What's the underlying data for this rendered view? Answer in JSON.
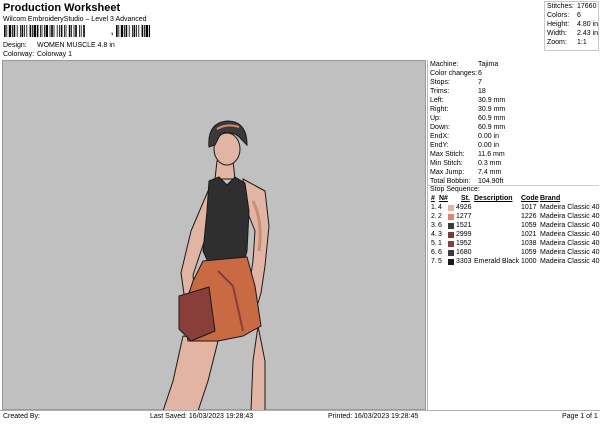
{
  "header": {
    "title": "Production Worksheet",
    "subtitle": "Wilcom EmbroideryStudio – Level 3 Advanced",
    "barcode_suffix": ",",
    "design_label": "Design:",
    "design_value": "WOMEN MUSCLE 4.8 in",
    "colorway_label": "Colorway:",
    "colorway_value": "Colorway 1"
  },
  "stats": [
    {
      "label": "Stitches:",
      "value": "17660"
    },
    {
      "label": "Colors:",
      "value": "6"
    },
    {
      "label": "Height:",
      "value": "4.80 in"
    },
    {
      "label": "Width:",
      "value": "2.43 in"
    },
    {
      "label": "Zoom:",
      "value": "1:1"
    }
  ],
  "machine_info": [
    {
      "label": "Machine:",
      "value": "Tajima"
    },
    {
      "label": "Color changes:",
      "value": "6"
    },
    {
      "label": "Stops:",
      "value": "7"
    },
    {
      "label": "Trims:",
      "value": "18"
    },
    {
      "label": "Left:",
      "value": "30.9 mm"
    },
    {
      "label": "Right:",
      "value": "30.9 mm"
    },
    {
      "label": "Up:",
      "value": "60.9 mm"
    },
    {
      "label": "Down:",
      "value": "60.9 mm"
    },
    {
      "label": "EndX:",
      "value": "0.00 in"
    },
    {
      "label": "EndY:",
      "value": "0.00 in"
    },
    {
      "label": "Max Stitch:",
      "value": "11.6 mm"
    },
    {
      "label": "Min Stitch:",
      "value": "0.3 mm"
    },
    {
      "label": "Max Jump:",
      "value": "7.4 mm"
    },
    {
      "label": "Total Bobbin:",
      "value": "104.90ft"
    }
  ],
  "stop_sequence": {
    "title": "Stop Sequence:",
    "columns": {
      "stop": "#",
      "n": "N#",
      "st": "St.",
      "description": "Description",
      "code": "Code",
      "brand": "Brand"
    },
    "rows": [
      {
        "stop": "1.",
        "n": "4",
        "color": "#e2b4a4",
        "st": "4926",
        "description": "",
        "code": "1017",
        "brand": "Madeira Classic 40"
      },
      {
        "stop": "2.",
        "n": "2",
        "color": "#d8866c",
        "st": "1277",
        "description": "",
        "code": "1226",
        "brand": "Madeira Classic 40"
      },
      {
        "stop": "3.",
        "n": "6",
        "color": "#3a3a3a",
        "st": "1521",
        "description": "",
        "code": "1059",
        "brand": "Madeira Classic 40"
      },
      {
        "stop": "4.",
        "n": "3",
        "color": "#7a3b2e",
        "st": "2999",
        "description": "",
        "code": "1021",
        "brand": "Madeira Classic 40"
      },
      {
        "stop": "5.",
        "n": "1",
        "color": "#8a3e3a",
        "st": "1952",
        "description": "",
        "code": "1038",
        "brand": "Madeira Classic 40"
      },
      {
        "stop": "6.",
        "n": "6",
        "color": "#3a3a3a",
        "st": "1680",
        "description": "",
        "code": "1059",
        "brand": "Madeira Classic 40"
      },
      {
        "stop": "7.",
        "n": "5",
        "color": "#1a1a1a",
        "st": "3303",
        "description": "Emerald Black",
        "code": "1000",
        "brand": "Madeira Classic 40"
      }
    ]
  },
  "footer": {
    "created_by": "Created By:",
    "last_saved": "Last Saved: 16/03/2023 19:28:43",
    "printed": "Printed: 16/03/2023 19:28:45",
    "page": "Page 1 of 1"
  },
  "design_colors": {
    "canvas": "#c0c0c0",
    "skin": "#e2b4a4",
    "skin_shadow": "#c88f74",
    "hair": "#3a3a3a",
    "tank": "#2f2f2f",
    "shorts": "#c96a42",
    "shorts_dark": "#8a3e3a",
    "outline": "#1a1a1a",
    "headband": "#d8866c"
  }
}
